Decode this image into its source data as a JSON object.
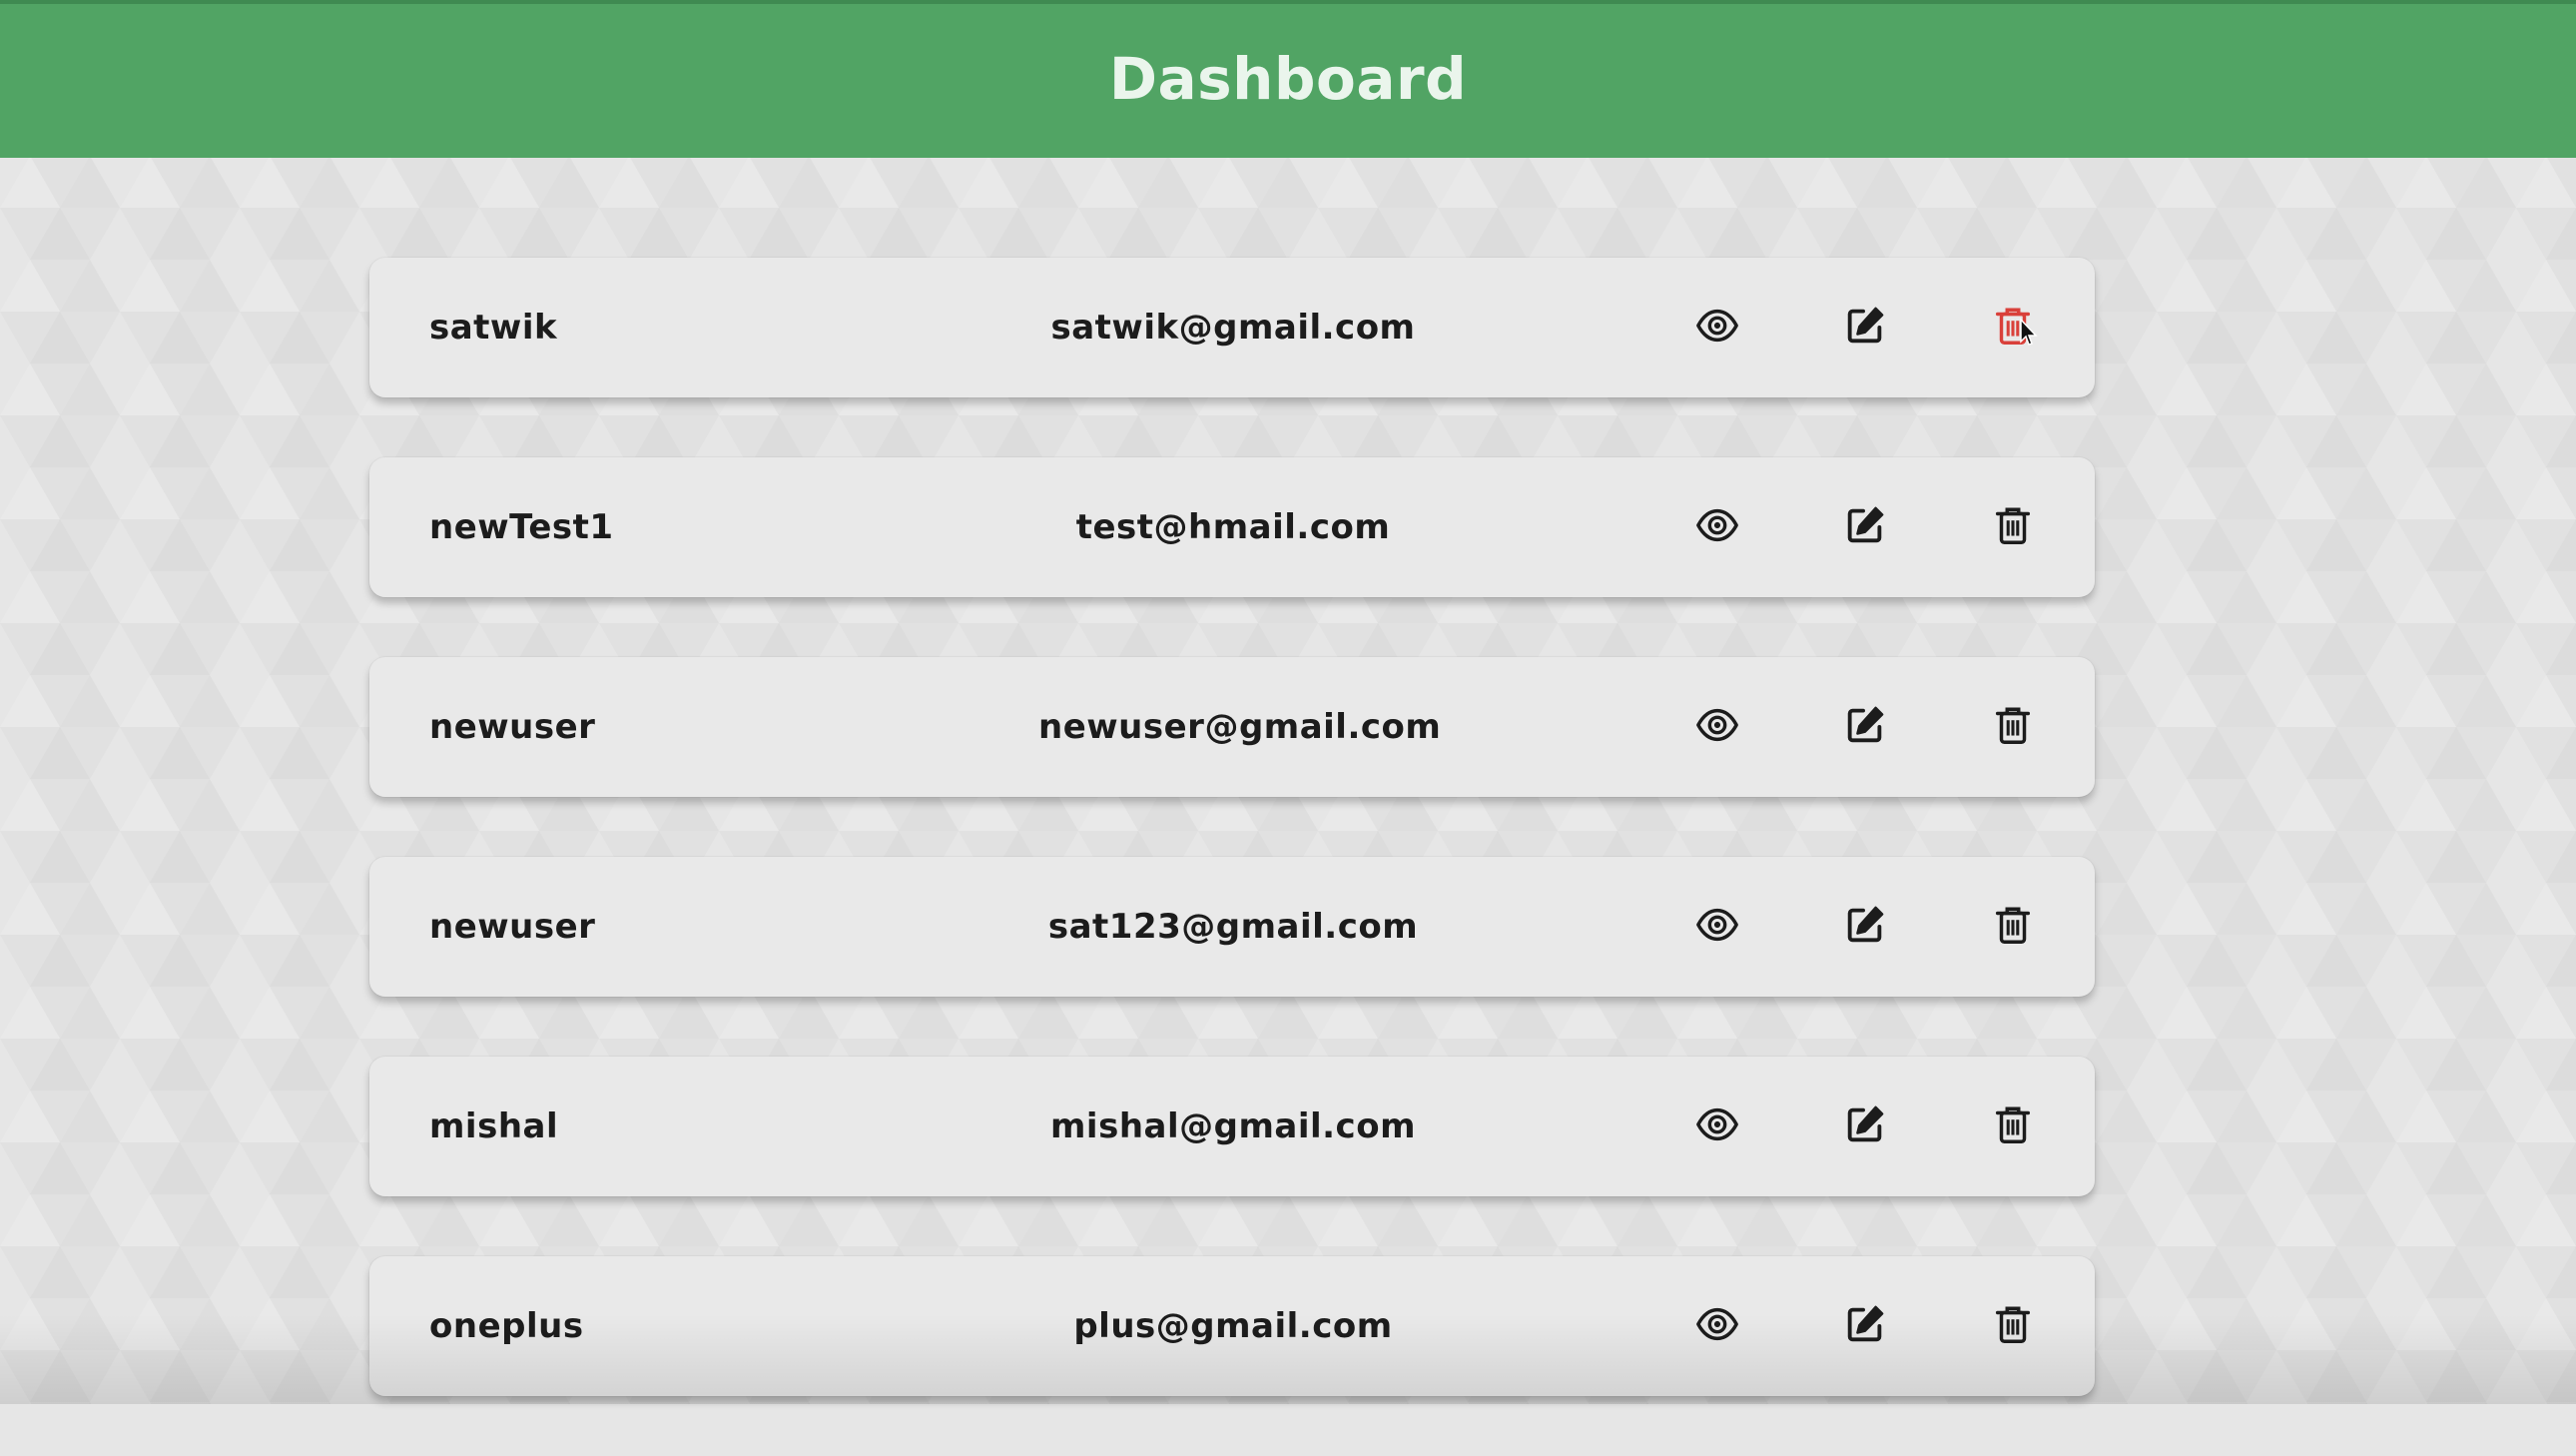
{
  "header": {
    "title": "Dashboard",
    "color": "#51a464"
  },
  "users": [
    {
      "name": "satwik",
      "email": "satwik@gmail.com",
      "delete_hovered": true
    },
    {
      "name": "newTest1",
      "email": "test@hmail.com",
      "delete_hovered": false
    },
    {
      "name": "newuser",
      "email": "newuser@gmail.com",
      "delete_hovered": false
    },
    {
      "name": "newuser",
      "email": "sat123@gmail.com",
      "delete_hovered": false
    },
    {
      "name": "mishal",
      "email": "mishal@gmail.com",
      "delete_hovered": false
    },
    {
      "name": "oneplus",
      "email": "plus@gmail.com",
      "delete_hovered": false
    }
  ],
  "icons": {
    "view": "eye-icon",
    "edit": "edit-icon",
    "delete": "trash-icon"
  },
  "colors": {
    "delete_hover": "#d9403a",
    "icon": "#1c1c1c",
    "card": "#e9e9e9"
  }
}
